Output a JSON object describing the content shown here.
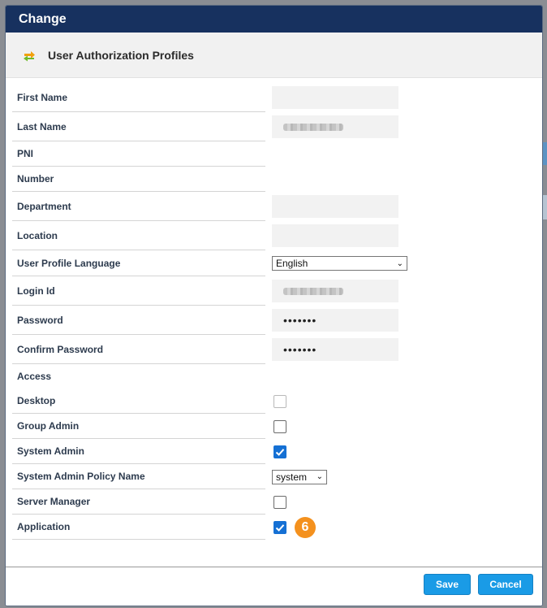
{
  "dialog": {
    "title": "Change",
    "section_title": "User Authorization Profiles",
    "section_icon": "arrows-swap-icon"
  },
  "fields": {
    "first_name": {
      "label": "First Name",
      "value": ""
    },
    "last_name": {
      "label": "Last Name"
    },
    "pni": {
      "label": "PNI"
    },
    "number": {
      "label": "Number"
    },
    "department": {
      "label": "Department",
      "value": ""
    },
    "location": {
      "label": "Location",
      "value": ""
    },
    "language": {
      "label": "User Profile Language",
      "value": "English"
    },
    "login_id": {
      "label": "Login Id"
    },
    "password": {
      "label": "Password",
      "value": "•••••••"
    },
    "confirm_password": {
      "label": "Confirm Password",
      "value": "•••••••"
    },
    "access": {
      "label": "Access"
    },
    "desktop": {
      "label": "Desktop",
      "checked": false,
      "disabled": true
    },
    "group_admin": {
      "label": "Group Admin",
      "checked": false
    },
    "system_admin": {
      "label": "System Admin",
      "checked": true
    },
    "system_admin_policy": {
      "label": "System Admin Policy Name",
      "value": "system"
    },
    "server_manager": {
      "label": "Server Manager",
      "checked": false
    },
    "application": {
      "label": "Application",
      "checked": true,
      "step": "6"
    }
  },
  "footer": {
    "save_label": "Save",
    "cancel_label": "Cancel"
  },
  "colors": {
    "titlebar": "#17315f",
    "button": "#1a9be6",
    "checkbox_checked": "#1570d4",
    "step_badge": "#f4911e"
  }
}
